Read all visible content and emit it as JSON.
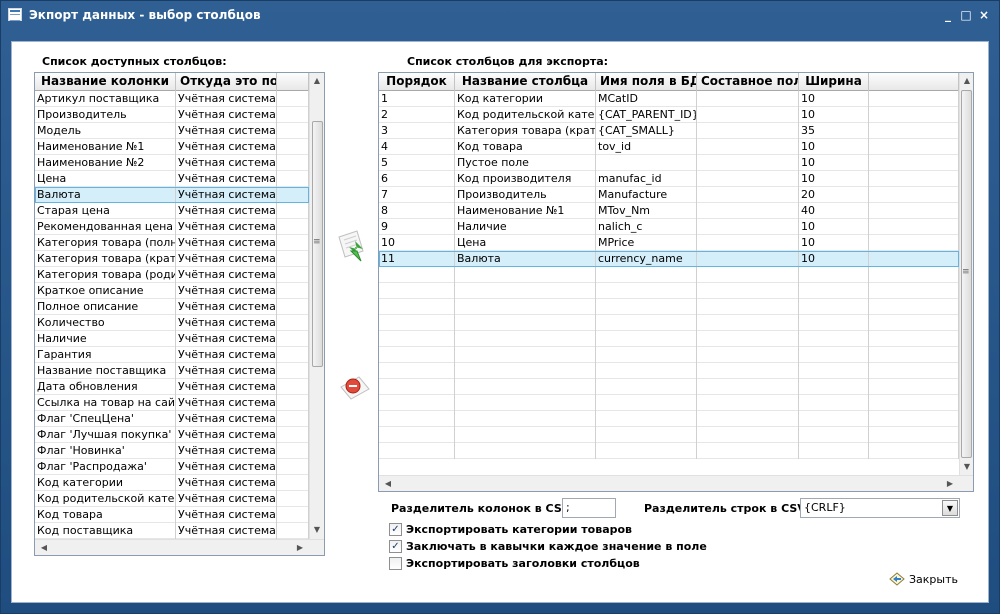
{
  "window": {
    "title": "Экпорт данных - выбор столбцов",
    "controls": [
      "_",
      "□",
      "×"
    ]
  },
  "left": {
    "label": "Список доступных столбцов:",
    "headers": [
      "Название колонки",
      "Откуда это поле"
    ],
    "selected_index": 6,
    "rows": [
      [
        "Артикул поставщика",
        "Учётная система"
      ],
      [
        "Производитель",
        "Учётная система"
      ],
      [
        "Модель",
        "Учётная система"
      ],
      [
        "Наименование №1",
        "Учётная система"
      ],
      [
        "Наименование №2",
        "Учётная система"
      ],
      [
        "Цена",
        "Учётная система"
      ],
      [
        "Валюта",
        "Учётная система"
      ],
      [
        "Старая цена",
        "Учётная система"
      ],
      [
        "Рекомендованная цена",
        "Учётная система"
      ],
      [
        "Категория товара (полная)",
        "Учётная система"
      ],
      [
        "Категория товара (краткая)",
        "Учётная система"
      ],
      [
        "Категория товара (родитель)",
        "Учётная система"
      ],
      [
        "Краткое описание",
        "Учётная система"
      ],
      [
        "Полное описание",
        "Учётная система"
      ],
      [
        "Количество",
        "Учётная система"
      ],
      [
        "Наличие",
        "Учётная система"
      ],
      [
        "Гарантия",
        "Учётная система"
      ],
      [
        "Название поставщика",
        "Учётная система"
      ],
      [
        "Дата обновления",
        "Учётная система"
      ],
      [
        "Ссылка на товар на сайте",
        "Учётная система"
      ],
      [
        "Флаг 'СпецЦена'",
        "Учётная система"
      ],
      [
        "Флаг 'Лучшая покупка'",
        "Учётная система"
      ],
      [
        "Флаг 'Новинка'",
        "Учётная система"
      ],
      [
        "Флаг 'Распродажа'",
        "Учётная система"
      ],
      [
        "Код категории",
        "Учётная система"
      ],
      [
        "Код родительской категории",
        "Учётная система"
      ],
      [
        "Код товара",
        "Учётная система"
      ],
      [
        "Код поставщика",
        "Учётная система"
      ]
    ]
  },
  "right": {
    "label": "Список столбцов для экспорта:",
    "headers": [
      "Порядок",
      "Название столбца",
      "Имя поля в БД",
      "Составное поле",
      "Ширина"
    ],
    "selected_index": 10,
    "rows": [
      [
        "1",
        "Код категории",
        "MCatID",
        "",
        "10"
      ],
      [
        "2",
        "Код родительской категории",
        "{CAT_PARENT_ID}",
        "",
        "10"
      ],
      [
        "3",
        "Категория товара (краткая)",
        "{CAT_SMALL}",
        "",
        "35"
      ],
      [
        "4",
        "Код товара",
        "tov_id",
        "",
        "10"
      ],
      [
        "5",
        "Пустое поле",
        "",
        "",
        "10"
      ],
      [
        "6",
        "Код производителя",
        "manufac_id",
        "",
        "10"
      ],
      [
        "7",
        "Производитель",
        "Manufacture",
        "",
        "20"
      ],
      [
        "8",
        "Наименование №1",
        "MTov_Nm",
        "",
        "40"
      ],
      [
        "9",
        "Наличие",
        "nalich_c",
        "",
        "10"
      ],
      [
        "10",
        "Цена",
        "MPrice",
        "",
        "10"
      ],
      [
        "11",
        "Валюта",
        "currency_name",
        "",
        "10"
      ]
    ]
  },
  "csv": {
    "col_sep_label": "Разделитель колонок в CSV:",
    "col_sep_value": ";",
    "row_sep_label": "Разделитель строк в CSV:",
    "row_sep_value": "{CRLF}"
  },
  "options": [
    {
      "label": "Экспортировать категории товаров",
      "checked": true
    },
    {
      "label": "Заключать в кавычки каждое значение в поле",
      "checked": true
    },
    {
      "label": "Экспортировать заголовки столбцов",
      "checked": false
    }
  ],
  "close_label": "Закрыть"
}
